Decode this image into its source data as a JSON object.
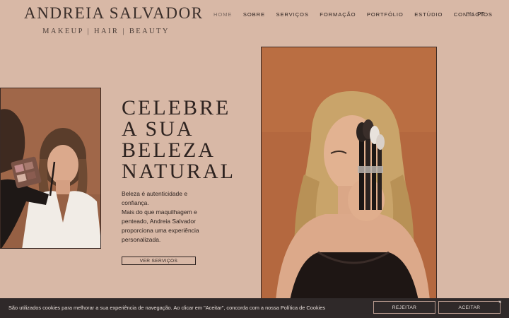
{
  "brand": {
    "name": "ANDREIA SALVADOR",
    "tagline": "MAKEUP | HAIR | BEAUTY"
  },
  "nav": {
    "items": [
      "HOME",
      "SOBRE",
      "SERVIÇOS",
      "FORMAÇÃO",
      "PORTFÓLIO",
      "ESTÚDIO",
      "CONTACTOS"
    ],
    "active": "HOME"
  },
  "languages": [
    "EN",
    "PT"
  ],
  "hero": {
    "headline": [
      "CELEBRE",
      "A SUA",
      "BELEZA",
      "NATURAL"
    ],
    "body": [
      "Beleza é autenticidade e confiança.",
      "Mais do que maquilhagem e penteado, Andreia Salvador proporciona uma experiência personalizada."
    ],
    "cta": "VER SERVIÇOS"
  },
  "cookie": {
    "text": "São utilizados cookies para melhorar a sua experiência de navegação. Ao clicar em \"Aceitar\", concorda com a nossa Política de Cookies",
    "reject": "REJEITAR",
    "accept": "ACEITAR",
    "close": "×"
  },
  "colors": {
    "background": "#d8b8a6",
    "text": "#2e2320",
    "cookie_bar": "#2f2929"
  }
}
